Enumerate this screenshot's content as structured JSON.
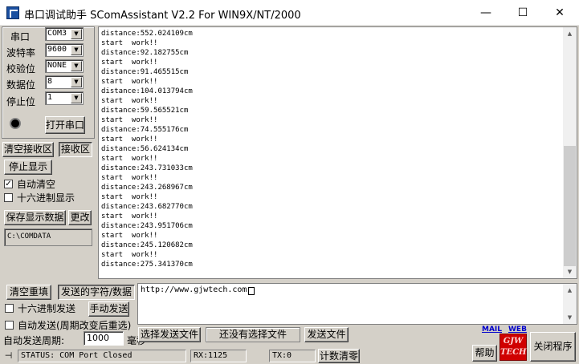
{
  "window": {
    "title": "串口调试助手 SComAssistant V2.2 For WIN9X/NT/2000",
    "minimize_glyph": "—",
    "maximize_glyph": "☐",
    "close_glyph": "✕"
  },
  "settings": {
    "port_label": "串口",
    "port_value": "COM3",
    "baud_label": "波特率",
    "baud_value": "9600",
    "parity_label": "校验位",
    "parity_value": "NONE",
    "databits_label": "数据位",
    "databits_value": "8",
    "stopbits_label": "停止位",
    "stopbits_value": "1",
    "open_port_button": "打开串口"
  },
  "receive": {
    "clear_button": "清空接收区",
    "area_label": "接收区",
    "stop_display_button": "停止显示",
    "auto_clear_label": "自动清空",
    "auto_clear_checked": true,
    "hex_display_label": "十六进制显示",
    "hex_display_checked": false,
    "save_button": "保存显示数据",
    "change_button": "更改",
    "save_path": "C:\\COMDATA",
    "text": "distance:552.024109cm\nstart  work!!\ndistance:92.182755cm\nstart  work!!\ndistance:91.465515cm\nstart  work!!\ndistance:104.013794cm\nstart  work!!\ndistance:59.565521cm\nstart  work!!\ndistance:74.555176cm\nstart  work!!\ndistance:56.624134cm\nstart  work!!\ndistance:243.731033cm\nstart  work!!\ndistance:243.268967cm\nstart  work!!\ndistance:243.682770cm\nstart  work!!\ndistance:243.951706cm\nstart  work!!\ndistance:245.120682cm\nstart  work!!\ndistance:275.341370cm"
  },
  "send": {
    "clear_resend_button": "清空重填",
    "send_area_label": "发送的字符/数据",
    "hex_send_label": "十六进制发送",
    "hex_send_checked": false,
    "manual_send_button": "手动发送",
    "auto_send_label": "自动发送(周期改变后重选)",
    "auto_send_checked": false,
    "period_label": "自动发送周期:",
    "period_value": "1000",
    "period_unit": "毫秒",
    "text": "http://www.gjwtech.com",
    "select_file_button": "选择发送文件",
    "file_status": "还没有选择文件",
    "send_file_button": "发送文件"
  },
  "links": {
    "mail": "MAIL",
    "web": "WEB"
  },
  "bottom": {
    "help_button": "帮助",
    "close_button": "关闭程序",
    "logo_line1": "GJW",
    "logo_line2": "TECH"
  },
  "status": {
    "status_text": "STATUS: COM Port Closed",
    "rx": "RX:1125",
    "tx": "TX:0",
    "reset_count_button": "计数清零"
  }
}
